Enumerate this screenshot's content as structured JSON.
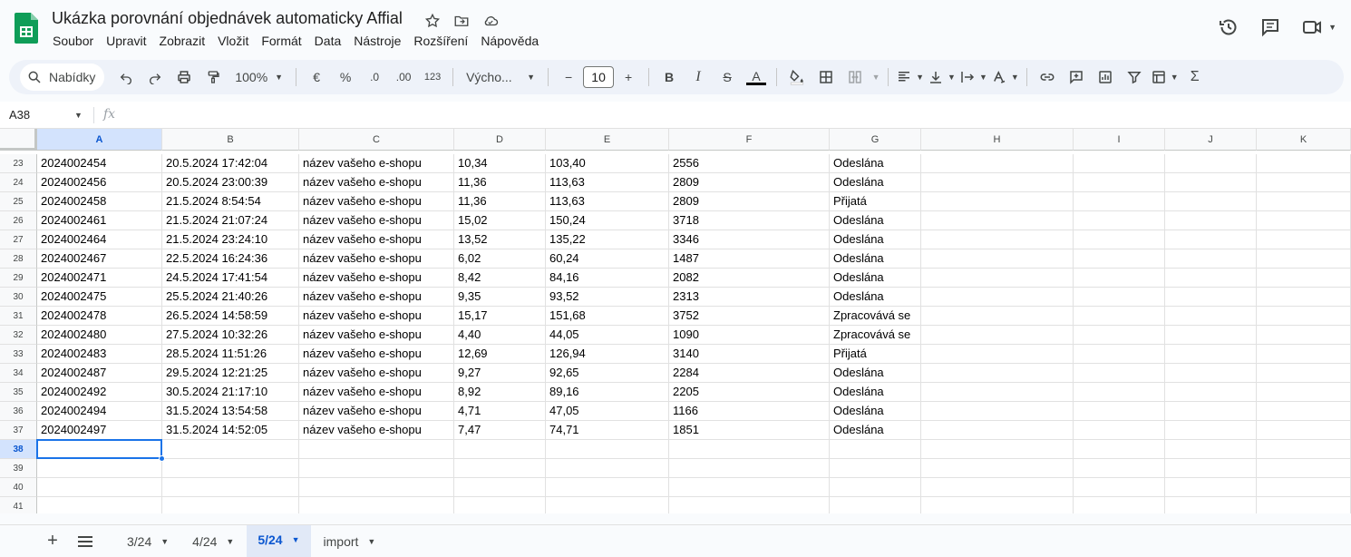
{
  "app": {
    "title": "Ukázka porovnání objednávek automaticky Affial",
    "menu": [
      "Soubor",
      "Upravit",
      "Zobrazit",
      "Vložit",
      "Formát",
      "Data",
      "Nástroje",
      "Rozšíření",
      "Nápověda"
    ]
  },
  "toolbar": {
    "search_label": "Nabídky",
    "zoom": "100%",
    "currency": "€",
    "percent": "%",
    "dec_decrease": ".0",
    "dec_increase": ".00",
    "number_format": "123",
    "font_name": "Výcho...",
    "font_size": "10",
    "minus": "−",
    "plus": "+",
    "bold": "B",
    "italic": "I",
    "strike": "S",
    "text_color_letter": "A",
    "sum": "Σ"
  },
  "formula_bar": {
    "name_box": "A38",
    "fx": "fx"
  },
  "columns": [
    "A",
    "B",
    "C",
    "D",
    "E",
    "F",
    "G",
    "H",
    "I",
    "J",
    "K"
  ],
  "rows": [
    {
      "n": "23",
      "cells": [
        "2024002454",
        "20.5.2024 17:42:04",
        "název vašeho e-shopu",
        "10,34",
        "103,40",
        "2556",
        "Odeslána"
      ]
    },
    {
      "n": "24",
      "cells": [
        "2024002456",
        "20.5.2024 23:00:39",
        "název vašeho e-shopu",
        "11,36",
        "113,63",
        "2809",
        "Odeslána"
      ]
    },
    {
      "n": "25",
      "cells": [
        "2024002458",
        "21.5.2024 8:54:54",
        "název vašeho e-shopu",
        "11,36",
        "113,63",
        "2809",
        "Přijatá"
      ]
    },
    {
      "n": "26",
      "cells": [
        "2024002461",
        "21.5.2024 21:07:24",
        "název vašeho e-shopu",
        "15,02",
        "150,24",
        "3718",
        "Odeslána"
      ]
    },
    {
      "n": "27",
      "cells": [
        "2024002464",
        "21.5.2024 23:24:10",
        "název vašeho e-shopu",
        "13,52",
        "135,22",
        "3346",
        "Odeslána"
      ]
    },
    {
      "n": "28",
      "cells": [
        "2024002467",
        "22.5.2024 16:24:36",
        "název vašeho e-shopu",
        "6,02",
        "60,24",
        "1487",
        "Odeslána"
      ]
    },
    {
      "n": "29",
      "cells": [
        "2024002471",
        "24.5.2024 17:41:54",
        "název vašeho e-shopu",
        "8,42",
        "84,16",
        "2082",
        "Odeslána"
      ]
    },
    {
      "n": "30",
      "cells": [
        "2024002475",
        "25.5.2024 21:40:26",
        "název vašeho e-shopu",
        "9,35",
        "93,52",
        "2313",
        "Odeslána"
      ]
    },
    {
      "n": "31",
      "cells": [
        "2024002478",
        "26.5.2024 14:58:59",
        "název vašeho e-shopu",
        "15,17",
        "151,68",
        "3752",
        "Zpracovává se"
      ]
    },
    {
      "n": "32",
      "cells": [
        "2024002480",
        "27.5.2024 10:32:26",
        "název vašeho e-shopu",
        "4,40",
        "44,05",
        "1090",
        "Zpracovává se"
      ]
    },
    {
      "n": "33",
      "cells": [
        "2024002483",
        "28.5.2024 11:51:26",
        "název vašeho e-shopu",
        "12,69",
        "126,94",
        "3140",
        "Přijatá"
      ]
    },
    {
      "n": "34",
      "cells": [
        "2024002487",
        "29.5.2024 12:21:25",
        "název vašeho e-shopu",
        "9,27",
        "92,65",
        "2284",
        "Odeslána"
      ]
    },
    {
      "n": "35",
      "cells": [
        "2024002492",
        "30.5.2024 21:17:10",
        "název vašeho e-shopu",
        "8,92",
        "89,16",
        "2205",
        "Odeslána"
      ]
    },
    {
      "n": "36",
      "cells": [
        "2024002494",
        "31.5.2024 13:54:58",
        "název vašeho e-shopu",
        "4,71",
        "47,05",
        "1166",
        "Odeslána"
      ]
    },
    {
      "n": "37",
      "cells": [
        "2024002497",
        "31.5.2024 14:52:05",
        "název vašeho e-shopu",
        "7,47",
        "74,71",
        "1851",
        "Odeslána"
      ]
    },
    {
      "n": "38",
      "cells": []
    },
    {
      "n": "39",
      "cells": []
    },
    {
      "n": "40",
      "cells": []
    },
    {
      "n": "41",
      "cells": []
    }
  ],
  "selection": {
    "column": "A",
    "row": "38"
  },
  "sheets": {
    "tabs": [
      "3/24",
      "4/24",
      "5/24",
      "import"
    ],
    "active": "5/24"
  },
  "colors": {
    "accent": "#0b57d0",
    "selection": "#1a73e8",
    "logo_green": "#0f9d58"
  }
}
